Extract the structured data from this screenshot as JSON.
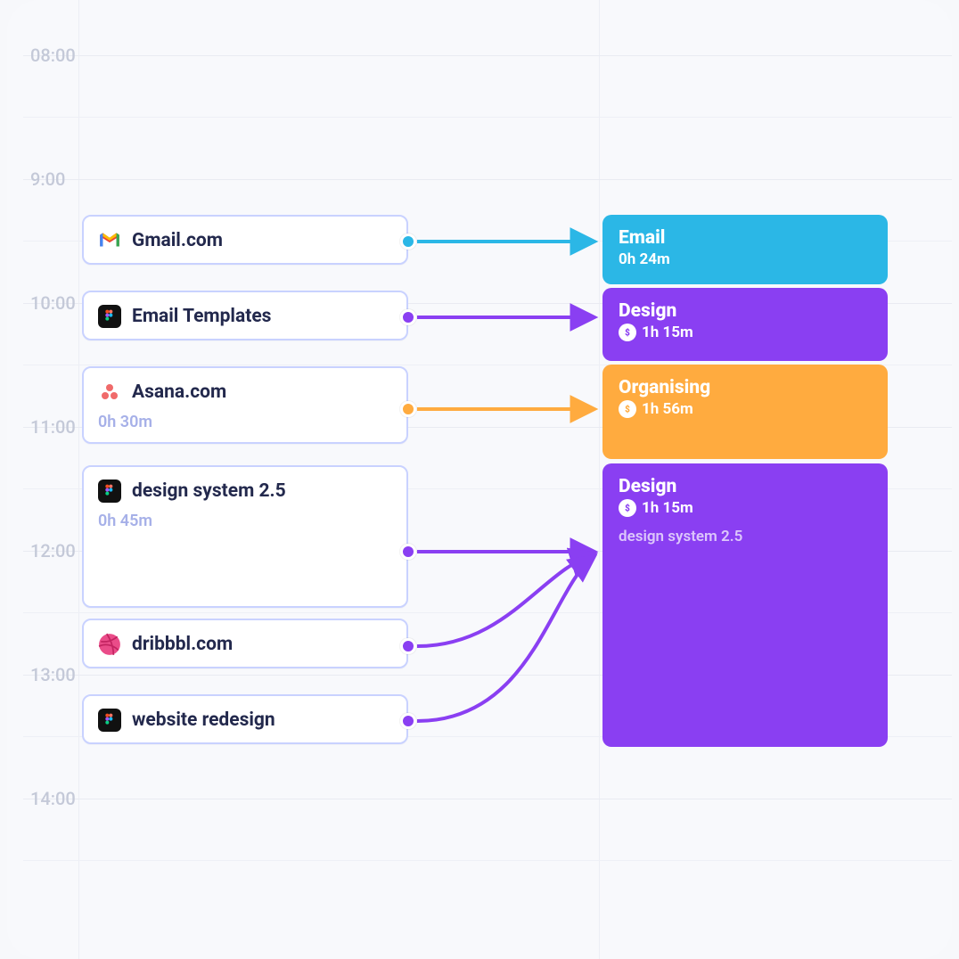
{
  "colors": {
    "blue": "#2bb7e6",
    "purple": "#8a3ff2",
    "orange": "#ffab3f",
    "violetBlock": "#8a3ff2"
  },
  "timeline": {
    "hours": [
      "08:00",
      "9:00",
      "10:00",
      "11:00",
      "12:00",
      "13:00",
      "14:00"
    ]
  },
  "activities": [
    {
      "id": "gmail",
      "icon": "gmail",
      "label": "Gmail.com",
      "sub": null,
      "color": "blue"
    },
    {
      "id": "templates",
      "icon": "figma",
      "label": "Email Templates",
      "sub": null,
      "color": "purple"
    },
    {
      "id": "asana",
      "icon": "asana",
      "label": "Asana.com",
      "sub": "0h 30m",
      "color": "orange"
    },
    {
      "id": "ds25",
      "icon": "figma",
      "label": "design system 2.5",
      "sub": "0h 45m",
      "color": "purple"
    },
    {
      "id": "dribbble",
      "icon": "dribbble",
      "label": "dribbbl.com",
      "sub": null,
      "color": "purple"
    },
    {
      "id": "redesign",
      "icon": "figma",
      "label": "website redesign",
      "sub": null,
      "color": "purple"
    }
  ],
  "categories": [
    {
      "id": "email",
      "title": "Email",
      "duration": "0h 24m",
      "billable": false,
      "color": "blue"
    },
    {
      "id": "design1",
      "title": "Design",
      "duration": "1h 15m",
      "billable": true,
      "color": "purple"
    },
    {
      "id": "organise",
      "title": "Organising",
      "duration": "1h 56m",
      "billable": true,
      "color": "orange"
    },
    {
      "id": "design2",
      "title": "Design",
      "duration": "1h 15m",
      "billable": true,
      "color": "purple",
      "note": "design system 2.5"
    }
  ]
}
